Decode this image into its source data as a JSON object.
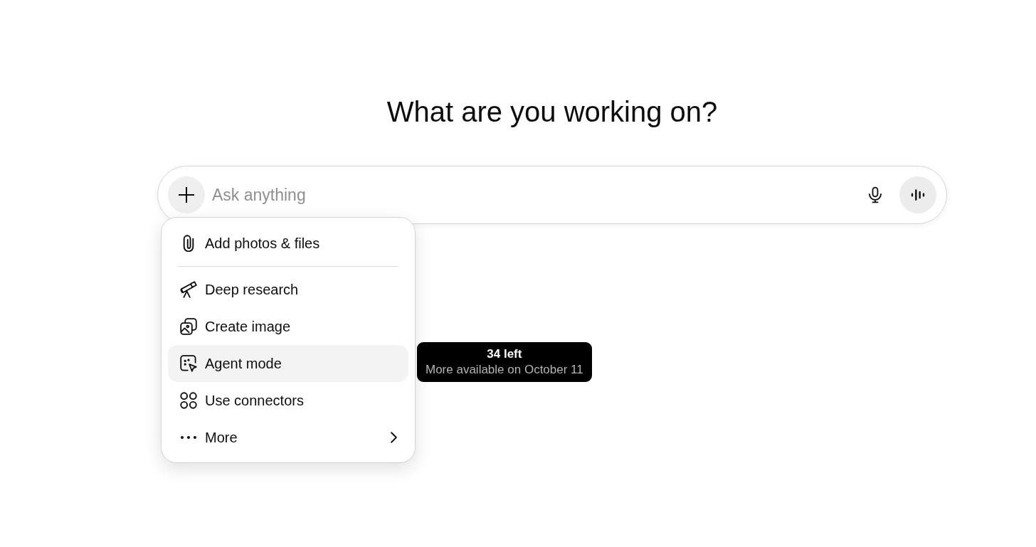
{
  "heading": "What are you working on?",
  "composer": {
    "placeholder": "Ask anything"
  },
  "menu": {
    "sections": [
      {
        "items": [
          {
            "label": "Add photos & files",
            "selected": false,
            "submenu": false
          }
        ]
      },
      {
        "items": [
          {
            "label": "Deep research",
            "selected": false,
            "submenu": false
          },
          {
            "label": "Create image",
            "selected": false,
            "submenu": false
          },
          {
            "label": "Agent mode",
            "selected": true,
            "submenu": false
          },
          {
            "label": "Use connectors",
            "selected": false,
            "submenu": false
          },
          {
            "label": "More",
            "selected": false,
            "submenu": true
          }
        ]
      }
    ]
  },
  "tooltip": {
    "title": "34 left",
    "detail": "More available on October 11"
  }
}
